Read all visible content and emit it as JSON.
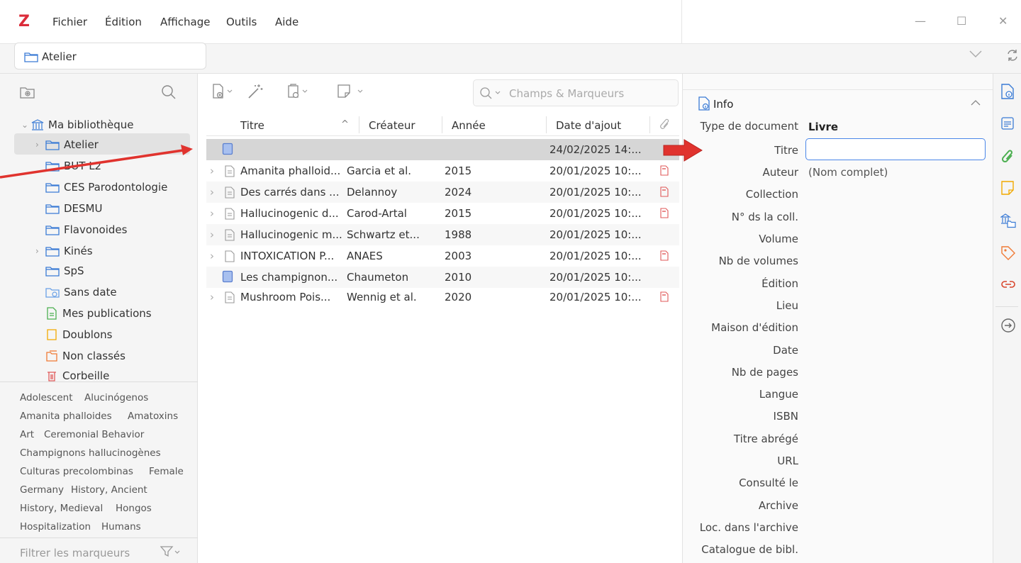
{
  "app": {
    "logo": "Z"
  },
  "menu": {
    "items": [
      "Fichier",
      "Édition",
      "Affichage",
      "Outils",
      "Aide"
    ]
  },
  "window_controls": {
    "minimize": "—",
    "maximize": "☐",
    "close": "✕"
  },
  "tab": {
    "label": "Atelier"
  },
  "colors": {
    "accent": "#4a86e8",
    "logo": "#db2c3a",
    "arrow": "#e0332e",
    "pdf": "#e05a5a",
    "book": "#5b7fcf",
    "attach": "#4caf50",
    "note": "#f2a900",
    "tag": "#f07a35",
    "related": "#d8452b"
  },
  "library": {
    "root": "Ma bibliothèque",
    "items": [
      {
        "label": "Atelier",
        "expandable": true,
        "selected": true
      },
      {
        "label": "BUT L2",
        "expandable": false
      },
      {
        "label": "CES Parodontologie",
        "expandable": false
      },
      {
        "label": "DESMU",
        "expandable": false
      },
      {
        "label": "Flavonoides",
        "expandable": false
      },
      {
        "label": "Kinés",
        "expandable": true
      },
      {
        "label": "SpS",
        "expandable": false
      }
    ],
    "special": [
      "Sans date",
      "Mes publications",
      "Doublons",
      "Non classés",
      "Corbeille"
    ]
  },
  "tags": {
    "lines": [
      [
        "Adolescent",
        "Alucinógenos"
      ],
      [
        "Amanita phalloides",
        "Amatoxins"
      ],
      [
        "Art",
        "Ceremonial Behavior"
      ],
      [
        "Champignons hallucinogènes"
      ],
      [
        "Culturas precolombinas",
        "Female"
      ],
      [
        "Germany",
        "History, Ancient"
      ],
      [
        "History, Medieval",
        "Hongos"
      ],
      [
        "Hospitalization",
        "Humans"
      ]
    ],
    "filter_placeholder": "Filtrer les marqueurs"
  },
  "search": {
    "placeholder": "Champs & Marqueurs"
  },
  "columns": {
    "title": "Titre",
    "creator": "Créateur",
    "year": "Année",
    "date_added": "Date d'ajout"
  },
  "rows": [
    {
      "title": "",
      "creator": "",
      "year": "",
      "date": "24/02/2025 14:...",
      "type": "book",
      "expandable": false,
      "pdf": false,
      "selected": true
    },
    {
      "title": "Amanita phalloid...",
      "creator": "Garcia et al.",
      "year": "2015",
      "date": "20/01/2025 10:...",
      "type": "article",
      "expandable": true,
      "pdf": true
    },
    {
      "title": "Des carrés dans ...",
      "creator": "Delannoy",
      "year": "2024",
      "date": "20/01/2025 10:...",
      "type": "article",
      "expandable": true,
      "pdf": true
    },
    {
      "title": "Hallucinogenic d...",
      "creator": "Carod-Artal",
      "year": "2015",
      "date": "20/01/2025 10:...",
      "type": "article",
      "expandable": true,
      "pdf": true
    },
    {
      "title": "Hallucinogenic m...",
      "creator": "Schwartz et...",
      "year": "1988",
      "date": "20/01/2025 10:...",
      "type": "article",
      "expandable": true,
      "pdf": false
    },
    {
      "title": "INTOXICATION P...",
      "creator": "ANAES",
      "year": "2003",
      "date": "20/01/2025 10:...",
      "type": "document",
      "expandable": true,
      "pdf": true
    },
    {
      "title": "Les champignon...",
      "creator": "Chaumeton",
      "year": "2010",
      "date": "20/01/2025 10:...",
      "type": "book",
      "expandable": false,
      "pdf": false
    },
    {
      "title": "Mushroom Pois...",
      "creator": "Wennig et al.",
      "year": "2020",
      "date": "20/01/2025 10:...",
      "type": "article",
      "expandable": true,
      "pdf": true
    }
  ],
  "info": {
    "header": "Info",
    "item_type_label": "Type de document",
    "item_type_value": "Livre",
    "author_label": "Auteur",
    "author_value": "(Nom complet)",
    "title_label": "Titre",
    "fields": [
      "Collection",
      "N° ds la coll.",
      "Volume",
      "Nb de volumes",
      "Édition",
      "Lieu",
      "Maison d'édition",
      "Date",
      "Nb de pages",
      "Langue",
      "ISBN",
      "Titre abrégé",
      "URL",
      "Consulté le",
      "Archive",
      "Loc. dans l'archive",
      "Catalogue de bibl."
    ]
  }
}
